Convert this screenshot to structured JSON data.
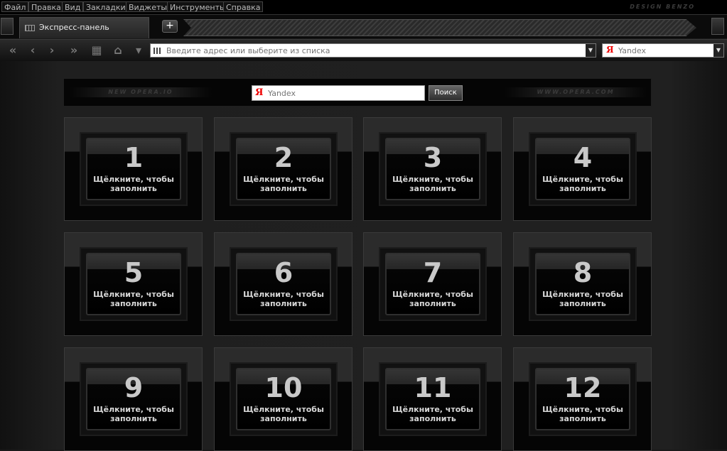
{
  "menu": {
    "items": [
      "Файл",
      "Правка",
      "Вид",
      "Закладки",
      "Виджеты",
      "Инструменты",
      "Справка"
    ],
    "brand": "DESIGN BENZO"
  },
  "tabs": {
    "active_title": "Экспресс-панель",
    "new_tab_label": "+"
  },
  "nav": {
    "address_placeholder": "Введите адрес или выберите из списка",
    "search_engine_value": "Yandex",
    "dropdown_glyph": "▼"
  },
  "speed_dial": {
    "left_deco": "NEW OPERA.IO",
    "right_deco": "WWW.OPERA.COM",
    "search_placeholder": "Yandex",
    "search_button": "Поиск",
    "yandex_glyph": "Я",
    "tiles": [
      {
        "number": "1",
        "text": "Щёлкните, чтобы заполнить"
      },
      {
        "number": "2",
        "text": "Щёлкните, чтобы заполнить"
      },
      {
        "number": "3",
        "text": "Щёлкните, чтобы заполнить"
      },
      {
        "number": "4",
        "text": "Щёлкните, чтобы заполнить"
      },
      {
        "number": "5",
        "text": "Щёлкните, чтобы заполнить"
      },
      {
        "number": "6",
        "text": "Щёлкните, чтобы заполнить"
      },
      {
        "number": "7",
        "text": "Щёлкните, чтобы заполнить"
      },
      {
        "number": "8",
        "text": "Щёлкните, чтобы заполнить"
      },
      {
        "number": "9",
        "text": "Щёлкните, чтобы заполнить"
      },
      {
        "number": "10",
        "text": "Щёлкните, чтобы заполнить"
      },
      {
        "number": "11",
        "text": "Щёлкните, чтобы заполнить"
      },
      {
        "number": "12",
        "text": "Щёлкните, чтобы заполнить"
      }
    ]
  },
  "colors": {
    "background": "#1a1a1a",
    "tile_top": "#2b2b2b",
    "tile_bottom": "#050505",
    "yandex_red": "#e00000"
  }
}
